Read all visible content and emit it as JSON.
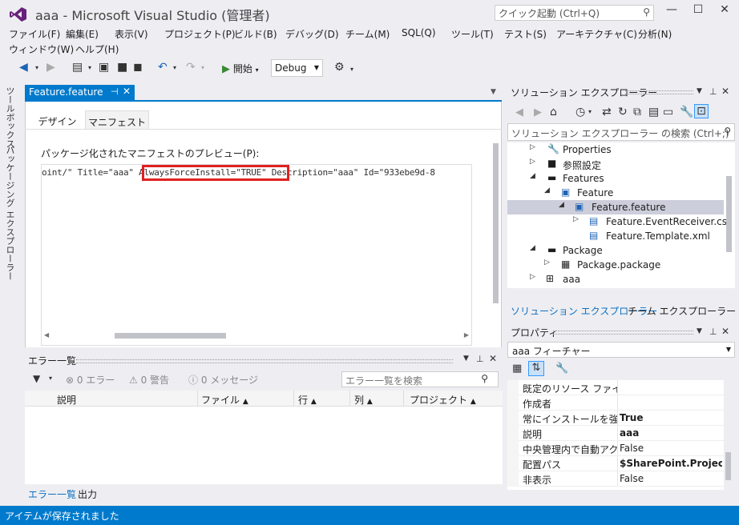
{
  "window": {
    "title": "aaa - Microsoft Visual Studio (管理者)",
    "quick_launch_placeholder": "クイック起動 (Ctrl+Q)"
  },
  "menu": {
    "items": [
      "ファイル(F)",
      "編集(E)",
      "表示(V)",
      "プロジェクト(P)",
      "ビルド(B)",
      "デバッグ(D)",
      "チーム(M)",
      "SQL(Q)",
      "ツール(T)",
      "テスト(S)",
      "アーキテクチャ(C)",
      "分析(N)",
      "ウィンドウ(W)",
      "ヘルプ(H)"
    ]
  },
  "toolbar": {
    "start_label": "開始",
    "config": "Debug"
  },
  "side_tabs": {
    "toolbox": "ツールボックス",
    "package_explorer": "パッケージング エクスプローラー"
  },
  "document": {
    "tab_label": "Feature.feature",
    "subtabs": {
      "design": "デザイン",
      "manifest": "マニフェスト"
    },
    "preview_label": "パッケージ化されたマニフェストのプレビュー(P):",
    "code_before": "oint/\" Title=\"aaa\" ",
    "code_highlight": "AlwaysForceInstall=\"TRUE\"",
    "code_after": " Description=\"aaa\" Id=\"933ebe9d-8"
  },
  "error_list": {
    "title": "エラー一覧",
    "errors": "0 エラー",
    "warnings": "0 警告",
    "messages": "0 メッセージ",
    "search_placeholder": "エラー一覧を検索",
    "columns": [
      "説明",
      "ファイル",
      "行",
      "列",
      "プロジェクト"
    ]
  },
  "bottom_tabs": [
    "エラー一覧",
    "出力"
  ],
  "solution_explorer": {
    "title": "ソリューション エクスプローラー",
    "search_placeholder": "ソリューション エクスプローラー の検索 (Ctrl+;)",
    "tree": [
      {
        "label": "Properties",
        "icon": "wrench-icon",
        "expander": "collapsed"
      },
      {
        "label": "参照設定",
        "icon": "references-icon",
        "expander": "collapsed"
      },
      {
        "label": "Features",
        "icon": "folder-icon",
        "expander": "expanded"
      },
      {
        "label": "Feature",
        "icon": "feature-icon",
        "expander": "expanded"
      },
      {
        "label": "Feature.feature",
        "icon": "feature-file-icon",
        "expander": "expanded",
        "selected": true
      },
      {
        "label": "Feature.EventReceiver.cs",
        "icon": "cs-file-icon",
        "expander": "collapsed"
      },
      {
        "label": "Feature.Template.xml",
        "icon": "xml-file-icon",
        "expander": "none"
      },
      {
        "label": "Package",
        "icon": "folder-icon",
        "expander": "expanded"
      },
      {
        "label": "Package.package",
        "icon": "package-icon",
        "expander": "collapsed"
      },
      {
        "label": "aaa",
        "icon": "project-icon",
        "expander": "collapsed"
      }
    ],
    "tabs": [
      "ソリューション エクスプローラー",
      "チーム エクスプローラー"
    ]
  },
  "properties": {
    "title": "プロパティ",
    "object": "aaa  フィーチャー",
    "rows": [
      {
        "key": "既定のリソース ファイル",
        "value": ""
      },
      {
        "key": "作成者",
        "value": ""
      },
      {
        "key": "常にインストールを強制",
        "value": "True",
        "bold": true
      },
      {
        "key": "説明",
        "value": "aaa",
        "bold": true
      },
      {
        "key": "中央管理内で自動アクテ",
        "value": "False"
      },
      {
        "key": "配置パス",
        "value": "$SharePoint.Project",
        "bold": true
      },
      {
        "key": "非表示",
        "value": "False"
      }
    ]
  },
  "status": {
    "text": "アイテムが保存されました"
  },
  "colors": {
    "accent": "#007acc",
    "highlight_border": "#e02020",
    "selection": "#cccedb"
  }
}
